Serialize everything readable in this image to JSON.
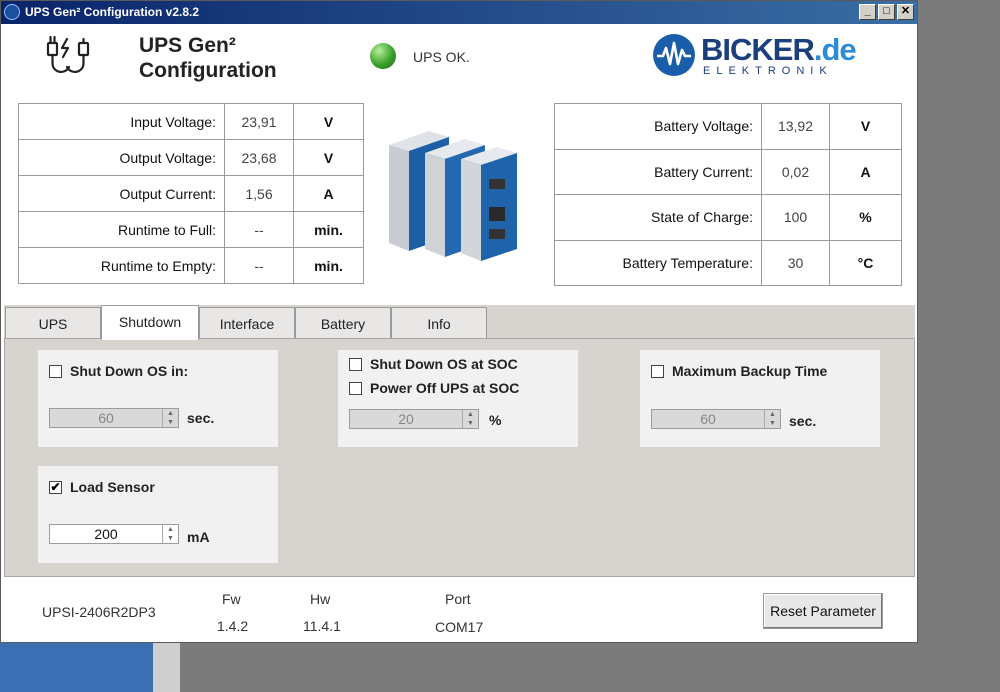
{
  "window": {
    "title": "UPS Gen² Configuration v2.8.2",
    "controls": {
      "minimize": "_",
      "maximize": "□",
      "close": "✕"
    }
  },
  "header": {
    "title_line1": "UPS Gen²",
    "title_line2": "Configuration",
    "status": "UPS OK.",
    "status_color": "#3aa12a",
    "logo_main": "BICKER",
    "logo_suffix": ".de",
    "logo_sub": "ELEKTRONIK"
  },
  "ups_values": [
    {
      "label": "Input Voltage:",
      "value": "23,91",
      "unit": "V"
    },
    {
      "label": "Output Voltage:",
      "value": "23,68",
      "unit": "V"
    },
    {
      "label": "Output Current:",
      "value": "1,56",
      "unit": "A"
    },
    {
      "label": "Runtime to Full:",
      "value": "--",
      "unit": "min."
    },
    {
      "label": "Runtime to Empty:",
      "value": "--",
      "unit": "min."
    }
  ],
  "battery_values": [
    {
      "label": "Battery Voltage:",
      "value": "13,92",
      "unit": "V"
    },
    {
      "label": "Battery Current:",
      "value": "0,02",
      "unit": "A"
    },
    {
      "label": "State of Charge:",
      "value": "100",
      "unit": "%"
    },
    {
      "label": "Battery Temperature:",
      "value": "30",
      "unit": "°C"
    }
  ],
  "tabs": [
    {
      "label": "UPS",
      "active": false
    },
    {
      "label": "Shutdown",
      "active": true
    },
    {
      "label": "Interface",
      "active": false
    },
    {
      "label": "Battery",
      "active": false
    },
    {
      "label": "Info",
      "active": false
    }
  ],
  "shutdown": {
    "shutdown_os_in": {
      "label": "Shut Down OS in:",
      "checked": false,
      "value": "60",
      "unit": "sec."
    },
    "soc_group": {
      "shutdown_os_at_soc": {
        "label": "Shut Down OS at SOC",
        "checked": false
      },
      "power_off_at_soc": {
        "label": "Power Off UPS at SOC",
        "checked": false
      },
      "value": "20",
      "unit": "%"
    },
    "max_backup": {
      "label": "Maximum Backup Time",
      "checked": false,
      "value": "60",
      "unit": "sec."
    },
    "load_sensor": {
      "label": "Load Sensor",
      "checked": true,
      "check_mark": "✔",
      "value": "200",
      "unit": "mA"
    }
  },
  "footer": {
    "model": "UPSI-2406R2DP3",
    "fw_label": "Fw",
    "fw_value": "1.4.2",
    "hw_label": "Hw",
    "hw_value": "11.4.1",
    "port_label": "Port",
    "port_value": "COM17",
    "reset_button": "Reset Parameter"
  }
}
